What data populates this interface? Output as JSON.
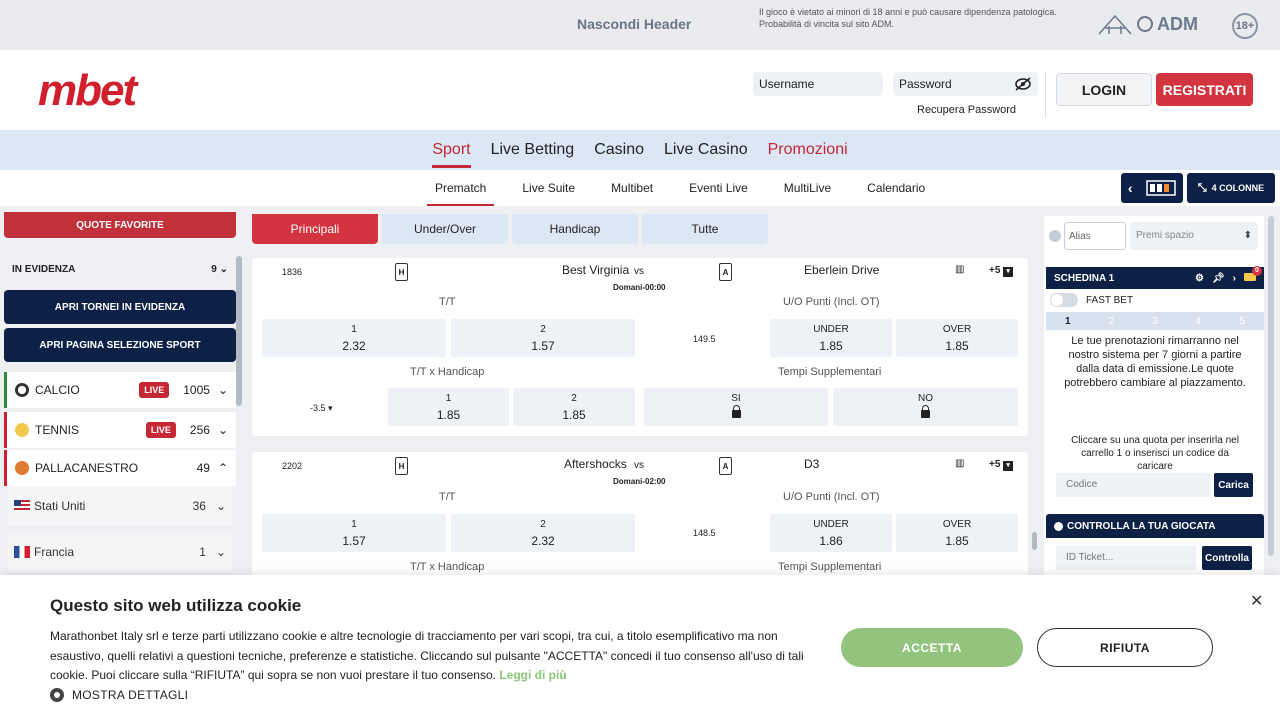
{
  "topbar": {
    "hide_header": "Nascondi Header",
    "disclaimer": "Il gioco è vietato ai minori di 18 anni e può causare dipendenza patologica. Probabilità di vincita sul sito ADM.",
    "adm_label": "ADM",
    "age_label": "18+"
  },
  "header": {
    "logo": "mbet",
    "username_placeholder": "Username",
    "password_placeholder": "Password",
    "recover_password": "Recupera Password",
    "login": "LOGIN",
    "register": "REGISTRATI"
  },
  "mainnav": [
    "Sport",
    "Live Betting",
    "Casino",
    "Live Casino",
    "Promozioni"
  ],
  "subnav": [
    "Prematch",
    "Live Suite",
    "Multibet",
    "Eventi Live",
    "MultiLive",
    "Calendario"
  ],
  "column_toggle": "4 COLONNE",
  "sidebar": {
    "quote_favorite": "QUOTE FAVORITE",
    "evidenza_label": "IN EVIDENZA",
    "evidenza_count": "9",
    "btn_tornei": "APRI TORNEI IN EVIDENZA",
    "btn_sport": "APRI PAGINA SELEZIONE SPORT",
    "sports": [
      {
        "name": "CALCIO",
        "live": "LIVE",
        "count": "1005"
      },
      {
        "name": "TENNIS",
        "live": "LIVE",
        "count": "256"
      },
      {
        "name": "PALLACANESTRO",
        "live": "",
        "count": "49"
      }
    ],
    "subsports": [
      {
        "name": "Stati Uniti",
        "count": "36"
      },
      {
        "name": "Francia",
        "count": "1"
      }
    ]
  },
  "tabs": [
    "Principali",
    "Under/Over",
    "Handicap",
    "Tutte"
  ],
  "events": [
    {
      "id": "1836",
      "home_icon": "H",
      "away_icon": "A",
      "home": "Best Virginia",
      "vs": "vs",
      "time": "Domani-00:00",
      "away": "Eberlein Drive",
      "more": "+5",
      "tt_label": "T/T",
      "uo_label": "U/O Punti (Incl. OT)",
      "odds_1_label": "1",
      "odds_1": "2.32",
      "odds_2_label": "2",
      "odds_2": "1.57",
      "line": "149.5",
      "under_label": "UNDER",
      "under": "1.85",
      "over_label": "OVER",
      "over": "1.85",
      "hcp_label": "T/T x Handicap",
      "extra_label": "Tempi Supplementari",
      "hcp_line": "-3.5",
      "hcp_1_label": "1",
      "hcp_1": "1.85",
      "hcp_2_label": "2",
      "hcp_2": "1.85",
      "si_label": "SI",
      "no_label": "NO"
    },
    {
      "id": "2202",
      "home_icon": "H",
      "away_icon": "A",
      "home": "Aftershocks",
      "vs": "vs",
      "time": "Domani-02:00",
      "away": "D3",
      "more": "+5",
      "tt_label": "T/T",
      "uo_label": "U/O Punti (Incl. OT)",
      "odds_1_label": "1",
      "odds_1": "1.57",
      "odds_2_label": "2",
      "odds_2": "2.32",
      "line": "148.5",
      "under_label": "UNDER",
      "under": "1.86",
      "over_label": "OVER",
      "over": "1.85",
      "hcp_label": "T/T x Handicap",
      "extra_label": "Tempi Supplementari"
    }
  ],
  "betslip": {
    "alias_placeholder": "Alias",
    "premi_placeholder": "Premi spazio",
    "title": "SCHEDINA 1",
    "badge": "0",
    "fast_bet": "FAST BET",
    "steps": [
      "1",
      "2",
      "3",
      "4",
      "5"
    ],
    "booking_info": "Le tue prenotazioni rimarranno nel nostro sistema per 7 giorni a partire dalla data di emissione.Le quote potrebbero cambiare al piazzamento.",
    "click_info": "Cliccare su una quota per inserirla nel carrello 1 o inserisci un codice da caricare",
    "code_placeholder": "Codice",
    "load": "Carica",
    "check_title": "CONTROLLA LA TUA GIOCATA",
    "ticket_placeholder": "ID Ticket...",
    "check": "Controlla"
  },
  "cookie": {
    "title": "Questo sito web utilizza cookie",
    "text": "Marathonbet Italy srl e terze parti utilizzano cookie e altre tecnologie di tracciamento per vari scopi, tra cui, a titolo esemplificativo ma non esaustivo, quelli relativi a questioni tecniche, preferenze e statistiche. Cliccando sul pulsante \"ACCETTA\" concedi il tuo consenso all'uso di tali cookie. Puoi cliccare sulla “RIFIUTA” qui sopra se non vuoi prestare il tuo consenso.",
    "link": "Leggi di più",
    "details": "MOSTRA DETTAGLI",
    "accept": "ACCETTA",
    "reject": "RIFIUTA",
    "close": "✕"
  },
  "colors": {
    "brand_red": "#d23440",
    "navy": "#0d2146",
    "accept_green": "#93c47d",
    "nav_blue": "#dce7f5"
  }
}
